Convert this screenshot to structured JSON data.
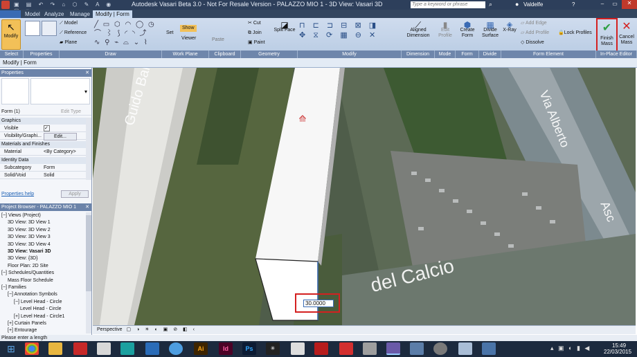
{
  "titlebar": {
    "title": "Autodesk Vasari Beta 3.0 - Not For Resale Version -     PALAZZO MIO 1 - 3D View: Vasari 3D",
    "search_placeholder": "Type a keyword or phrase",
    "user": "Valdelfe"
  },
  "tabs": [
    "Model",
    "Analyze",
    "Manage",
    "Modify | Form"
  ],
  "ribbon": {
    "modify": "Modify",
    "model": "Model",
    "reference": "Reference",
    "plane": "Plane",
    "set": "Set",
    "show": "Show",
    "viewer": "Viewer",
    "paste": "Paste",
    "cut": "Cut",
    "join": "Join",
    "paint": "Paint",
    "split_face": "Split Face",
    "aligned_dimension": "Aligned Dimension",
    "edit_profile": "Edit Profile",
    "create_form": "Create Form",
    "divide_surface": "Divide Surface",
    "xray": "X-Ray",
    "add_edge": "Add Edge",
    "add_profile": "Add Profile",
    "dissolve": "Dissolve",
    "lock_profiles": "Lock Profiles",
    "finish_mass": "Finish Mass",
    "cancel_mass": "Cancel Mass"
  },
  "panel_labels": [
    "Select",
    "Properties",
    "Draw",
    "Work Plane",
    "Clipboard",
    "Geometry",
    "Modify",
    "Dimension",
    "Mode",
    "Form",
    "Divide",
    "Form Element",
    "In-Place Editor"
  ],
  "context_bar": "Modify | Form",
  "properties": {
    "header": "Properties",
    "type_selector": "Form (1)",
    "edit_type": "Edit Type",
    "groups": [
      {
        "name": "Graphics",
        "rows": [
          {
            "k": "Visible",
            "v": "✓"
          },
          {
            "k": "Visibility/Graphi...",
            "v": "Edit..."
          }
        ]
      },
      {
        "name": "Materials and Finishes",
        "rows": [
          {
            "k": "Material",
            "v": "<By Category>"
          }
        ]
      },
      {
        "name": "Identity Data",
        "rows": [
          {
            "k": "Subcategory",
            "v": "Form"
          },
          {
            "k": "Solid/Void",
            "v": "Solid"
          }
        ]
      }
    ],
    "help": "Properties help",
    "apply": "Apply"
  },
  "browser": {
    "header": "Project Browser - PALAZZO MIO 1",
    "items": [
      {
        "label": "Views (Project)",
        "level": 0,
        "bold": false,
        "sign": "−"
      },
      {
        "label": "3D View: 3D View 1",
        "level": 1,
        "bold": false
      },
      {
        "label": "3D View: 3D View 2",
        "level": 1,
        "bold": false
      },
      {
        "label": "3D View: 3D View 3",
        "level": 1,
        "bold": false
      },
      {
        "label": "3D View: 3D View 4",
        "level": 1,
        "bold": false
      },
      {
        "label": "3D View: Vasari 3D",
        "level": 1,
        "bold": true
      },
      {
        "label": "3D View: {3D}",
        "level": 1,
        "bold": false
      },
      {
        "label": "Floor Plan: 2D Site",
        "level": 1,
        "bold": false
      },
      {
        "label": "Schedules/Quantities",
        "level": 0,
        "bold": false,
        "sign": "−"
      },
      {
        "label": "Mass Floor Schedule",
        "level": 1,
        "bold": false
      },
      {
        "label": "Families",
        "level": 0,
        "bold": false,
        "sign": "−"
      },
      {
        "label": "Annotation Symbols",
        "level": 1,
        "bold": false,
        "sign": "−"
      },
      {
        "label": "Level Head - Circle",
        "level": 2,
        "bold": false,
        "sign": "−"
      },
      {
        "label": "Level Head - Circle",
        "level": 3,
        "bold": false
      },
      {
        "label": "Level Head - Circle1",
        "level": 2,
        "bold": false,
        "sign": "+"
      },
      {
        "label": "Curtain Panels",
        "level": 1,
        "bold": false,
        "sign": "+"
      },
      {
        "label": "Entourage",
        "level": 1,
        "bold": false,
        "sign": "+"
      }
    ]
  },
  "viewport": {
    "street_labels": [
      "Guido Banti di Nerva",
      "Via Alberto",
      "Asc",
      "del Calcio"
    ],
    "dimension_value": "30.0000"
  },
  "viewbar": {
    "label": "Perspective"
  },
  "status": "Please enter a length",
  "clock": {
    "time": "15:49",
    "date": "22/03/2015"
  },
  "colors": {
    "titlebar": "#2d3f5b",
    "ribbon": "#c5d6ec",
    "panel_label": "#6e86ab",
    "highlight": "#d42020"
  }
}
